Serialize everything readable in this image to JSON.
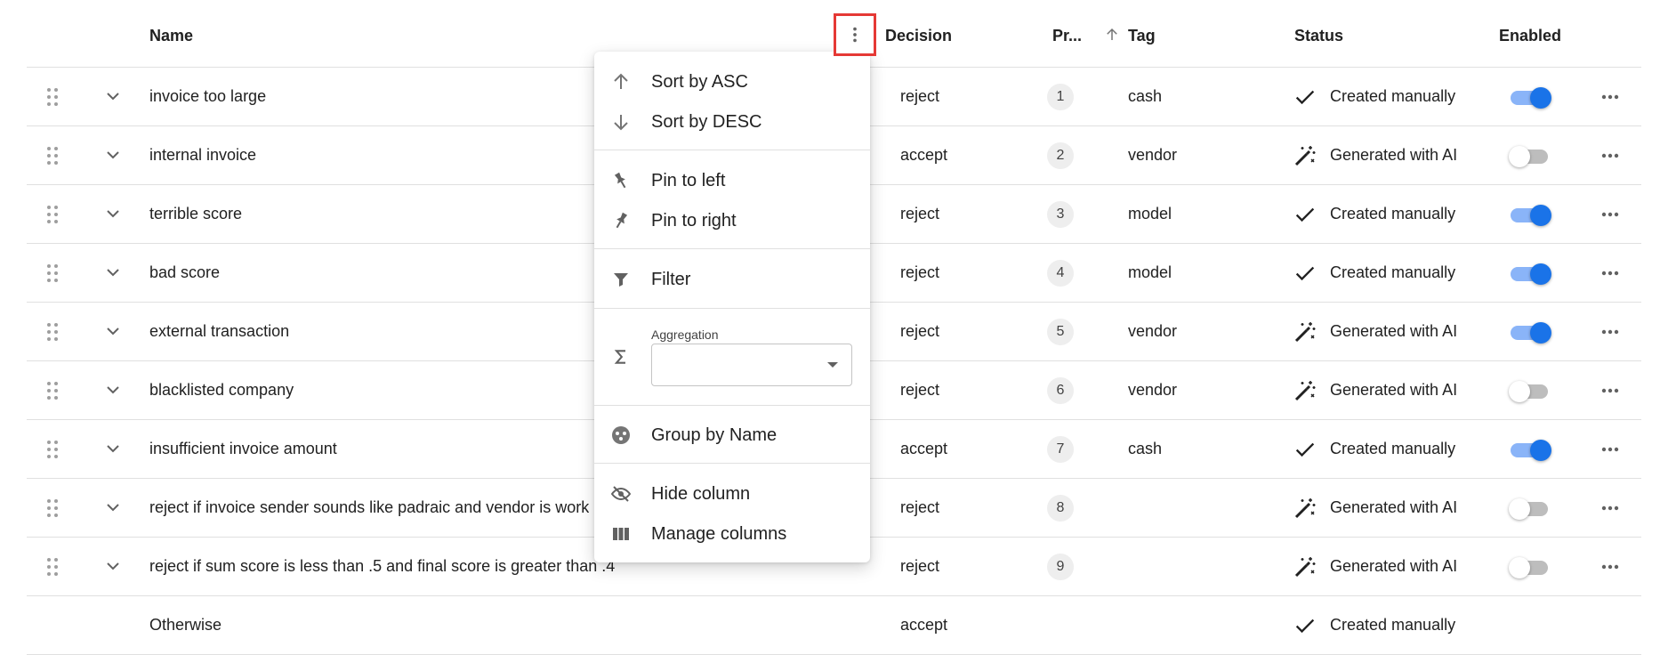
{
  "columns": {
    "name": "Name",
    "decision": "Decision",
    "priority": "Pr...",
    "tag": "Tag",
    "status": "Status",
    "enabled": "Enabled"
  },
  "sort": {
    "column": "priority",
    "direction": "asc"
  },
  "rows": [
    {
      "name": "invoice too large",
      "decision": "reject",
      "priority": "1",
      "tag": "cash",
      "status": "Created manually",
      "status_icon": "check-icon",
      "enabled": true
    },
    {
      "name": "internal invoice",
      "decision": "accept",
      "priority": "2",
      "tag": "vendor",
      "status": "Generated with AI",
      "status_icon": "magic-wand-icon",
      "enabled": false
    },
    {
      "name": "terrible score",
      "decision": "reject",
      "priority": "3",
      "tag": "model",
      "status": "Created manually",
      "status_icon": "check-icon",
      "enabled": true
    },
    {
      "name": "bad score",
      "decision": "reject",
      "priority": "4",
      "tag": "model",
      "status": "Created manually",
      "status_icon": "check-icon",
      "enabled": true
    },
    {
      "name": "external transaction",
      "decision": "reject",
      "priority": "5",
      "tag": "vendor",
      "status": "Generated with AI",
      "status_icon": "magic-wand-icon",
      "enabled": true
    },
    {
      "name": "blacklisted company",
      "decision": "reject",
      "priority": "6",
      "tag": "vendor",
      "status": "Generated with AI",
      "status_icon": "magic-wand-icon",
      "enabled": false
    },
    {
      "name": "insufficient invoice amount",
      "decision": "accept",
      "priority": "7",
      "tag": "cash",
      "status": "Created manually",
      "status_icon": "check-icon",
      "enabled": true
    },
    {
      "name": "reject if invoice sender sounds like padraic and vendor is work",
      "decision": "reject",
      "priority": "8",
      "tag": "",
      "status": "Generated with AI",
      "status_icon": "magic-wand-icon",
      "enabled": false
    },
    {
      "name": "reject if sum score is less than .5 and final score is greater than .4",
      "decision": "reject",
      "priority": "9",
      "tag": "",
      "status": "Generated with AI",
      "status_icon": "magic-wand-icon",
      "enabled": false
    }
  ],
  "otherwise": {
    "name": "Otherwise",
    "decision": "accept",
    "status": "Created manually"
  },
  "column_menu": {
    "sort_asc": "Sort by ASC",
    "sort_desc": "Sort by DESC",
    "pin_left": "Pin to left",
    "pin_right": "Pin to right",
    "filter": "Filter",
    "aggregation_label": "Aggregation",
    "aggregation_value": "",
    "group_by": "Group by Name",
    "hide_column": "Hide column",
    "manage_columns": "Manage columns"
  },
  "colors": {
    "accent": "#1a73e8",
    "highlight_border": "#e53935"
  }
}
